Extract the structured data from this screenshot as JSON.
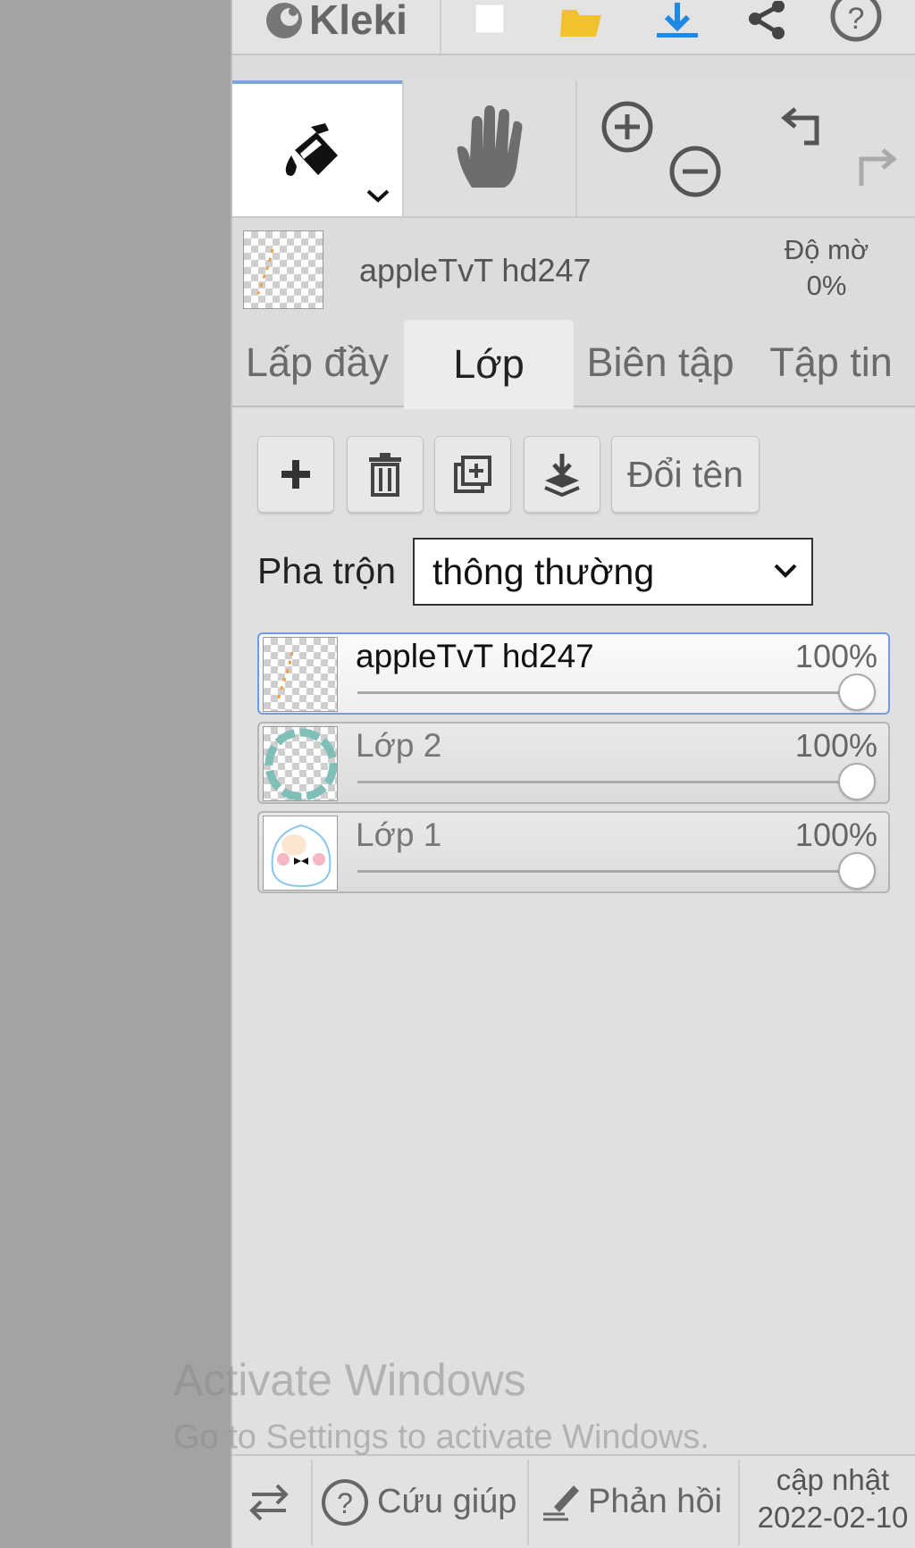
{
  "app": {
    "name": "Kleki"
  },
  "toolbar": {
    "icons": [
      "new-image-icon",
      "open-folder-icon",
      "download-icon",
      "share-icon",
      "help-icon"
    ]
  },
  "tools": {
    "active_tool": "fill-bucket-icon",
    "items": [
      "fill-bucket-icon",
      "hand-icon",
      "zoom-in-icon",
      "zoom-out-icon",
      "undo-icon",
      "redo-icon"
    ]
  },
  "layer_info": {
    "name": "appleTvT hd247",
    "opacity_label": "Độ mờ",
    "opacity_value": "0%"
  },
  "tabs": [
    {
      "label": "Lấp đầy",
      "active": false
    },
    {
      "label": "Lớp",
      "active": true
    },
    {
      "label": "Biên tập",
      "active": false
    },
    {
      "label": "Tập tin",
      "active": false
    }
  ],
  "layer_buttons": {
    "icons": [
      "plus-icon",
      "trash-icon",
      "duplicate-icon",
      "merge-down-icon"
    ],
    "rename_label": "Đổi tên"
  },
  "blend": {
    "label": "Pha trộn",
    "value": "thông thường"
  },
  "layers": [
    {
      "name": "appleTvT hd247",
      "opacity": "100%",
      "opacity_fraction": 1.0,
      "selected": true
    },
    {
      "name": "Lớp 2",
      "opacity": "100%",
      "opacity_fraction": 1.0,
      "selected": false
    },
    {
      "name": "Lớp 1",
      "opacity": "100%",
      "opacity_fraction": 1.0,
      "selected": false
    }
  ],
  "watermark": {
    "line1": "Activate Windows",
    "line2": "Go to Settings to activate Windows."
  },
  "bottom": {
    "help_label": "Cứu giúp",
    "feedback_label": "Phản hồi",
    "update_label": "cập nhật",
    "update_date": "2022-02-10"
  },
  "colors": {
    "accent": "#6f9ee0",
    "folder": "#f2c12e",
    "download": "#1e88e5"
  }
}
